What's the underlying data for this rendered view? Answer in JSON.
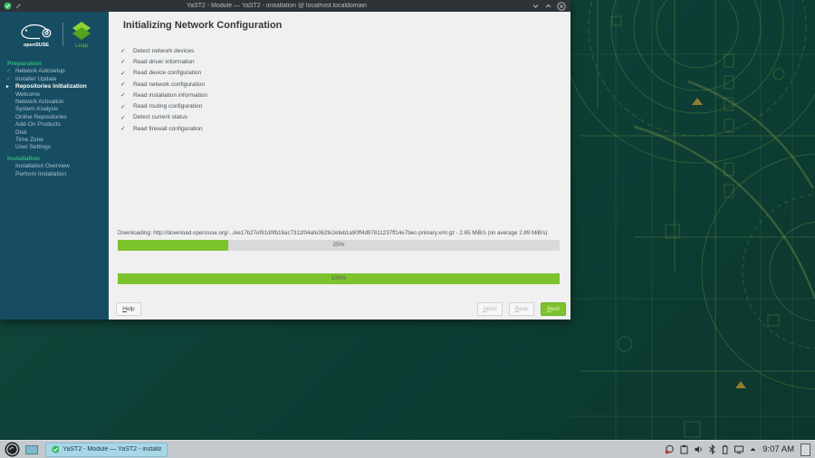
{
  "window": {
    "title": "YaST2 - Module — YaST2 - installation @ localhost.localdomain"
  },
  "sidebar": {
    "brand": {
      "opensuse": "openSUSE",
      "leap": "Leap"
    },
    "sections": [
      {
        "label": "Preparation",
        "items": [
          {
            "label": "Network Autosetup",
            "state": "done"
          },
          {
            "label": "Installer Update",
            "state": "done"
          },
          {
            "label": "Repositories Initialization",
            "state": "current"
          },
          {
            "label": "Welcome",
            "state": "pending"
          },
          {
            "label": "Network Activation",
            "state": "pending"
          },
          {
            "label": "System Analysis",
            "state": "pending"
          },
          {
            "label": "Online Repositories",
            "state": "pending"
          },
          {
            "label": "Add-On Products",
            "state": "pending"
          },
          {
            "label": "Disk",
            "state": "pending"
          },
          {
            "label": "Time Zone",
            "state": "pending"
          },
          {
            "label": "User Settings",
            "state": "pending"
          }
        ]
      },
      {
        "label": "Installation",
        "items": [
          {
            "label": "Installation Overview",
            "state": "pending"
          },
          {
            "label": "Perform Installation",
            "state": "pending"
          }
        ]
      }
    ]
  },
  "main": {
    "title": "Initializing Network Configuration",
    "tasks": [
      "Detect network devices",
      "Read driver information",
      "Read device configuration",
      "Read network configuration",
      "Read installation information",
      "Read routing configuration",
      "Detect current status",
      "Read firewall configuration"
    ],
    "download_status": "Downloading: http://download.opensuse.org/.../ee17b27ef91d0fb16ac7311f04afe362fe2efeb1a90ff4d97811237ff14e7bec-primary.xml.gz - 2.65 MiB/s (on average 2.89 MiB/s)",
    "progress_current": {
      "percent": 25,
      "label": "25%"
    },
    "progress_total": {
      "percent": 100,
      "label": "100%"
    },
    "buttons": {
      "help": "Help",
      "abort": "Abort",
      "back": "Back",
      "next": "Next"
    }
  },
  "taskbar": {
    "task_title": "YaST2 - Module — YaST2 - installat...",
    "clock": "9:07 AM",
    "tray_icons": [
      "notifications",
      "clipboard",
      "volume",
      "bluetooth",
      "battery",
      "display",
      "expand-caret"
    ]
  },
  "icons": {
    "check": "✓",
    "arrow": "▸"
  },
  "colors": {
    "accent_green": "#73ba25",
    "progress_green": "#7cc32e",
    "section_green": "#30ba78",
    "sidebar_bg": "#174d62",
    "titlebar_bg": "#2e3338",
    "desktop_bg": "#0e4137",
    "taskbar_bg": "#c3c9cc",
    "task_highlight": "#a9d7e8"
  }
}
